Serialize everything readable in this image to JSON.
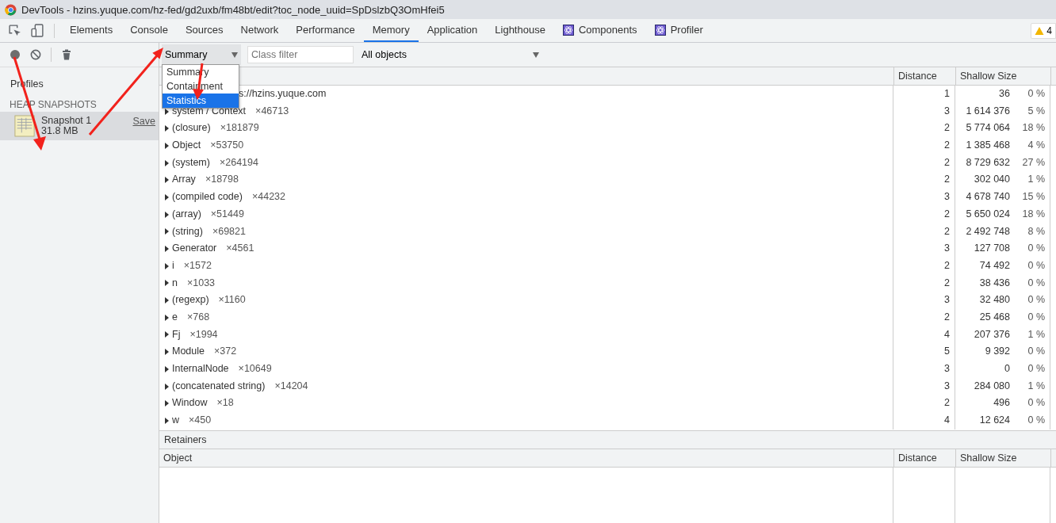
{
  "window": {
    "title": "DevTools - hzins.yuque.com/hz-fed/gd2uxb/fm48bt/edit?toc_node_uuid=SpDslzbQ3OmHfei5"
  },
  "tabs": [
    {
      "label": "Elements",
      "selected": false,
      "kind": "plain"
    },
    {
      "label": "Console",
      "selected": false,
      "kind": "plain"
    },
    {
      "label": "Sources",
      "selected": false,
      "kind": "plain"
    },
    {
      "label": "Network",
      "selected": false,
      "kind": "plain"
    },
    {
      "label": "Performance",
      "selected": false,
      "kind": "plain"
    },
    {
      "label": "Memory",
      "selected": true,
      "kind": "plain"
    },
    {
      "label": "Application",
      "selected": false,
      "kind": "plain"
    },
    {
      "label": "Lighthouse",
      "selected": false,
      "kind": "plain"
    },
    {
      "label": "Components",
      "selected": false,
      "kind": "react"
    },
    {
      "label": "Profiler",
      "selected": false,
      "kind": "react"
    }
  ],
  "warning_badge": "4",
  "sidebar": {
    "title": "Profiles",
    "section": "HEAP SNAPSHOTS",
    "snapshots": [
      {
        "name": "Snapshot 1",
        "size": "31.8 MB",
        "action": "Save",
        "selected": true
      }
    ]
  },
  "toolbar": {
    "view": "Summary",
    "class_filter_placeholder": "Class filter",
    "scope": "All objects"
  },
  "view_menu": [
    {
      "label": "Summary",
      "selected": false
    },
    {
      "label": "Containment",
      "selected": false
    },
    {
      "label": "Statistics",
      "selected": true
    }
  ],
  "table": {
    "columns": [
      "Distance",
      "Shallow Size"
    ],
    "rows": [
      {
        "kind": "partial",
        "name": "s://hzins.yuque.com",
        "count": "",
        "distance": "1",
        "size": "36",
        "percent": "0 %"
      },
      {
        "kind": "node",
        "name": "system / Context",
        "count": "×46713",
        "distance": "3",
        "size": "1 614 376",
        "percent": "5 %"
      },
      {
        "kind": "node",
        "name": "(closure)",
        "count": "×181879",
        "distance": "2",
        "size": "5 774 064",
        "percent": "18 %"
      },
      {
        "kind": "node",
        "name": "Object",
        "count": "×53750",
        "distance": "2",
        "size": "1 385 468",
        "percent": "4 %"
      },
      {
        "kind": "node",
        "name": "(system)",
        "count": "×264194",
        "distance": "2",
        "size": "8 729 632",
        "percent": "27 %"
      },
      {
        "kind": "node",
        "name": "Array",
        "count": "×18798",
        "distance": "2",
        "size": "302 040",
        "percent": "1 %"
      },
      {
        "kind": "node",
        "name": "(compiled code)",
        "count": "×44232",
        "distance": "3",
        "size": "4 678 740",
        "percent": "15 %"
      },
      {
        "kind": "node",
        "name": "(array)",
        "count": "×51449",
        "distance": "2",
        "size": "5 650 024",
        "percent": "18 %"
      },
      {
        "kind": "node",
        "name": "(string)",
        "count": "×69821",
        "distance": "2",
        "size": "2 492 748",
        "percent": "8 %"
      },
      {
        "kind": "node",
        "name": "Generator",
        "count": "×4561",
        "distance": "3",
        "size": "127 708",
        "percent": "0 %"
      },
      {
        "kind": "node",
        "name": "i",
        "count": "×1572",
        "distance": "2",
        "size": "74 492",
        "percent": "0 %"
      },
      {
        "kind": "node",
        "name": "n",
        "count": "×1033",
        "distance": "2",
        "size": "38 436",
        "percent": "0 %"
      },
      {
        "kind": "node",
        "name": "(regexp)",
        "count": "×1160",
        "distance": "3",
        "size": "32 480",
        "percent": "0 %"
      },
      {
        "kind": "node",
        "name": "e",
        "count": "×768",
        "distance": "2",
        "size": "25 468",
        "percent": "0 %"
      },
      {
        "kind": "node",
        "name": "Fj",
        "count": "×1994",
        "distance": "4",
        "size": "207 376",
        "percent": "1 %"
      },
      {
        "kind": "node",
        "name": "Module",
        "count": "×372",
        "distance": "5",
        "size": "9 392",
        "percent": "0 %"
      },
      {
        "kind": "node",
        "name": "InternalNode",
        "count": "×10649",
        "distance": "3",
        "size": "0",
        "percent": "0 %"
      },
      {
        "kind": "node",
        "name": "(concatenated string)",
        "count": "×14204",
        "distance": "3",
        "size": "284 080",
        "percent": "1 %"
      },
      {
        "kind": "node",
        "name": "Window",
        "count": "×18",
        "distance": "2",
        "size": "496",
        "percent": "0 %"
      },
      {
        "kind": "node",
        "name": "w",
        "count": "×450",
        "distance": "4",
        "size": "12 624",
        "percent": "0 %"
      }
    ]
  },
  "retainers": {
    "title": "Retainers",
    "columns": [
      "Object",
      "Distance",
      "Shallow Size"
    ]
  },
  "annotations": [
    {
      "kind": "arrow"
    },
    {
      "kind": "arrow"
    },
    {
      "kind": "arrow"
    }
  ]
}
